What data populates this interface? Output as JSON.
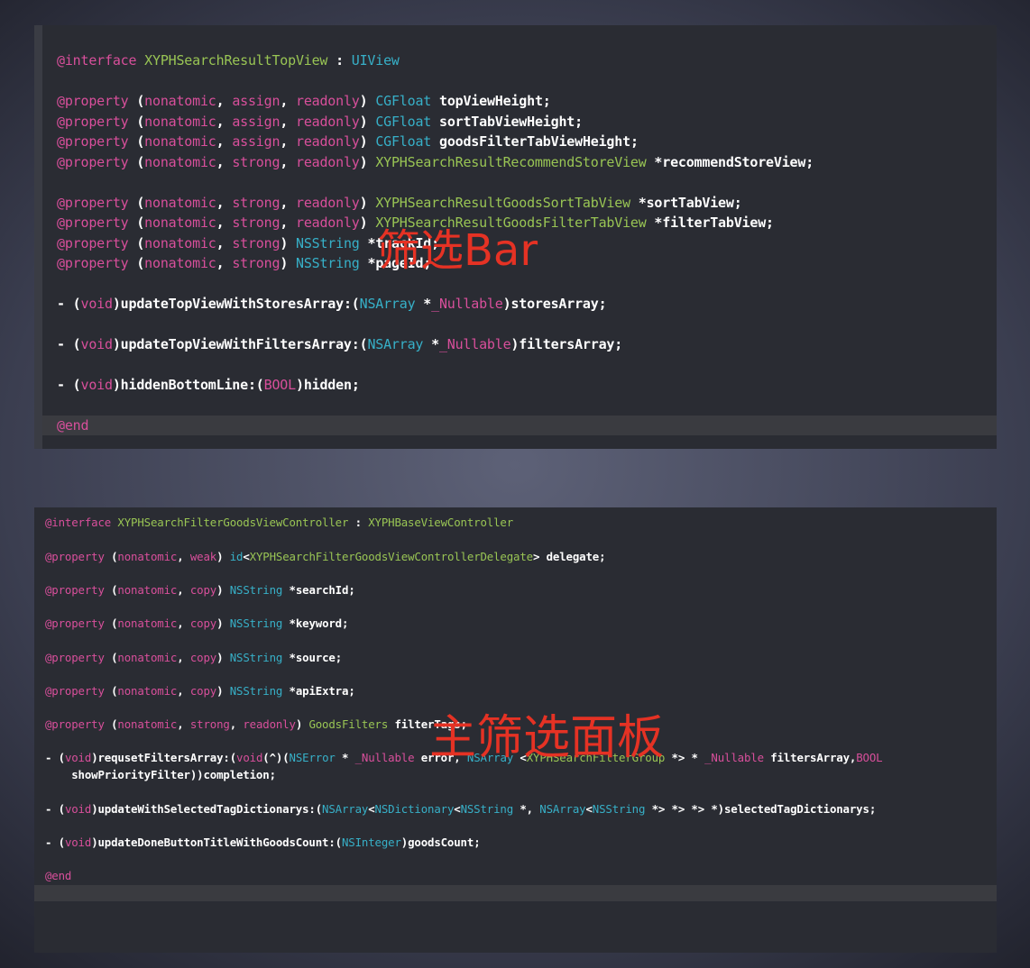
{
  "panel_top": {
    "lines": [
      {
        "t": "@interface XYPHSearchResultTopView : UIView"
      },
      {
        "t": "@property (nonatomic, assign, readonly) CGFloat topViewHeight;"
      },
      {
        "t": "@property (nonatomic, assign, readonly) CGFloat sortTabViewHeight;"
      },
      {
        "t": "@property (nonatomic, assign, readonly) CGFloat goodsFilterTabViewHeight;"
      },
      {
        "t": "@property (nonatomic, strong, readonly) XYPHSearchResultRecommendStoreView *recommendStoreView;"
      },
      {
        "t": "@property (nonatomic, strong, readonly) XYPHSearchResultGoodsSortTabView *sortTabView;"
      },
      {
        "t": "@property (nonatomic, strong, readonly) XYPHSearchResultGoodsFilterTabView *filterTabView;"
      },
      {
        "t": "@property (nonatomic, strong) NSString *trackId;"
      },
      {
        "t": "@property (nonatomic, strong) NSString *pageId;"
      },
      {
        "t": "- (void)updateTopViewWithStoresArray:(NSArray *_Nullable)storesArray;"
      },
      {
        "t": "- (void)updateTopViewWithFiltersArray:(NSArray *_Nullable)filtersArray;"
      },
      {
        "t": "- (void)hiddenBottomLine:(BOOL)hidden;"
      },
      {
        "t": "@end"
      }
    ],
    "annotation": "筛选Bar"
  },
  "panel_bottom": {
    "lines": [
      {
        "t": "@interface XYPHSearchFilterGoodsViewController : XYPHBaseViewController"
      },
      {
        "t": "@property (nonatomic, weak) id<XYPHSearchFilterGoodsViewControllerDelegate> delegate;"
      },
      {
        "t": "@property (nonatomic, copy) NSString *searchId;"
      },
      {
        "t": "@property (nonatomic, copy) NSString *keyword;"
      },
      {
        "t": "@property (nonatomic, copy) NSString *source;"
      },
      {
        "t": "@property (nonatomic, copy) NSString *apiExtra;"
      },
      {
        "t": "@property (nonatomic, strong, readonly) GoodsFilters filterTags;"
      },
      {
        "t": "- (void)requsetFiltersArray:(void(^)(NSError * _Nullable error, NSArray <XYPHSearchFilterGroup *> * _Nullable filtersArray,BOOL"
      },
      {
        "t": "    showPriorityFilter))completion;"
      },
      {
        "t": "- (void)updateWithSelectedTagDictionarys:(NSArray<NSDictionary<NSString *, NSArray<NSString *> *> *> *)selectedTagDictionarys;"
      },
      {
        "t": "- (void)updateDoneButtonTitleWithGoodsCount:(NSInteger)goodsCount;"
      },
      {
        "t": "@end"
      }
    ],
    "annotation": "主筛选面板"
  },
  "colors": {
    "keyword": "#d84f9b",
    "type": "#37b0c8",
    "class": "#99c554",
    "annotation": "#e53224",
    "editor_bg": "#2a2c33"
  }
}
